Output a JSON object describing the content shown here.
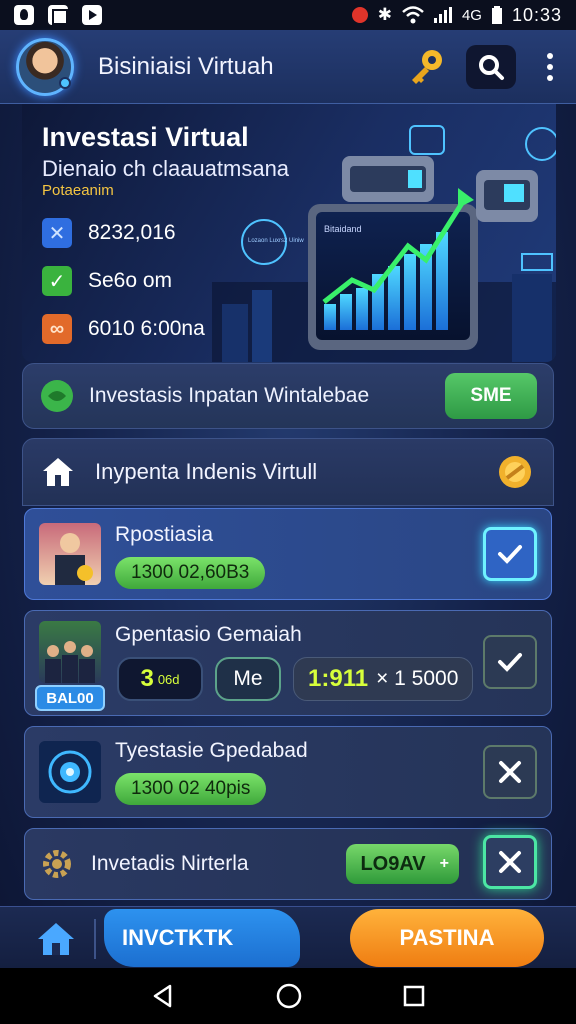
{
  "status_bar": {
    "left_icons": [
      "flame-icon",
      "image-icon",
      "play-icon"
    ],
    "network": "4G",
    "time": "10:33"
  },
  "header": {
    "title": "Bisiniaisi Virtuah",
    "icons": [
      "key-icon",
      "search-icon",
      "more-vertical-icon"
    ]
  },
  "hero": {
    "title": "Investasi Virtual",
    "subtitle": "Dienaio ch claauatmsana",
    "tag": "Potaeanim",
    "stats": [
      {
        "icon": "cross-icon",
        "value": "8232,016"
      },
      {
        "icon": "check-icon",
        "value": "Se6o om"
      },
      {
        "icon": "link-icon",
        "value": "6010 6:00na"
      }
    ],
    "board_label": "Bitaidand",
    "bubble_text": "Lozaon Luxrs2 Uiniw"
  },
  "promo": {
    "text": "Investasis Inpatan Wintalebae",
    "button": "SME"
  },
  "section": {
    "title": "Inypenta Indenis Virtull"
  },
  "items": [
    {
      "name": "Rpostiasia",
      "value": "1300 02,60B3",
      "state": "checked"
    },
    {
      "name": "Gpentasio Gemaiah",
      "chip1": "3",
      "chip1_small": "06d",
      "chip2": "Me",
      "chip3_accent": "1:911",
      "chip3_text": "× 1 5000",
      "badge": "BAL00",
      "state": "checked"
    },
    {
      "name": "Tyestasie Gpedabad",
      "value": "1300 02 40pis",
      "state": "unchecked"
    },
    {
      "name": "Invetadis Nirterla",
      "level": "LO9AV",
      "level_plus": "+",
      "state": "unchecked"
    }
  ],
  "bottom_nav": {
    "primary_tab": "INVCTKTK",
    "secondary_tab": "PASTINA"
  },
  "colors": {
    "accent_blue": "#2d92ef",
    "accent_green": "#3fa83b",
    "accent_orange": "#ef7d12",
    "background": "#14224a"
  }
}
